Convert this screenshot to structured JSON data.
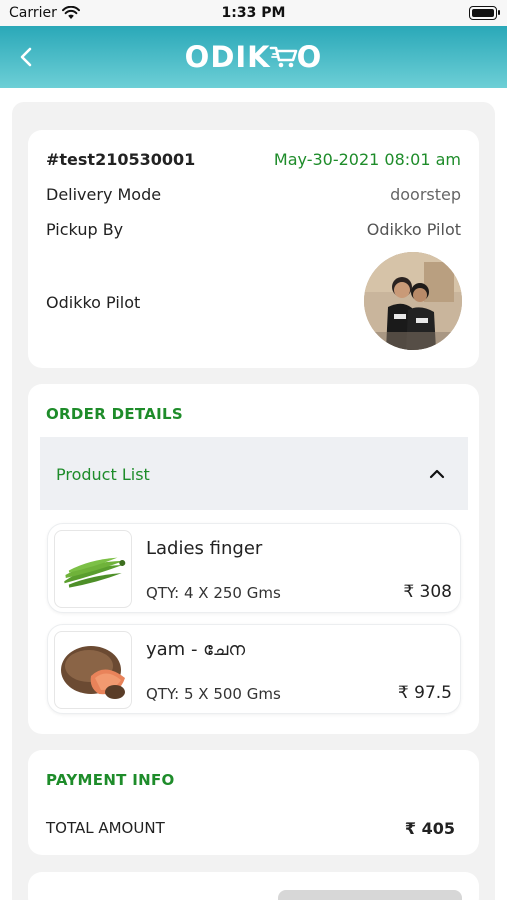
{
  "status_bar": {
    "carrier": "Carrier",
    "time": "1:33 PM"
  },
  "header": {
    "logo_text_left": "ODIK",
    "logo_text_right": "O",
    "brand_color": "#2aa8b8",
    "back_icon": "chevron-left-icon"
  },
  "order": {
    "id": "#test210530001",
    "datetime": "May-30-2021 08:01 am",
    "delivery_mode_label": "Delivery Mode",
    "delivery_mode_value": "doorstep",
    "pickup_by_label": "Pickup By",
    "pickup_by_value": "Odikko Pilot",
    "pilot_name": "Odikko Pilot",
    "accent_color": "#1e8c2a"
  },
  "order_details": {
    "title": "ORDER DETAILS",
    "product_list_label": "Product List",
    "items": [
      {
        "name": "Ladies finger",
        "qty": "QTY: 4 X 250 Gms",
        "price": "₹ 308"
      },
      {
        "name": "yam - ചേന",
        "qty": "QTY: 5 X 500 Gms",
        "price": "₹ 97.5"
      }
    ]
  },
  "payment": {
    "title": "PAYMENT INFO",
    "total_label": "TOTAL AMOUNT",
    "total_value": "₹ 405"
  }
}
